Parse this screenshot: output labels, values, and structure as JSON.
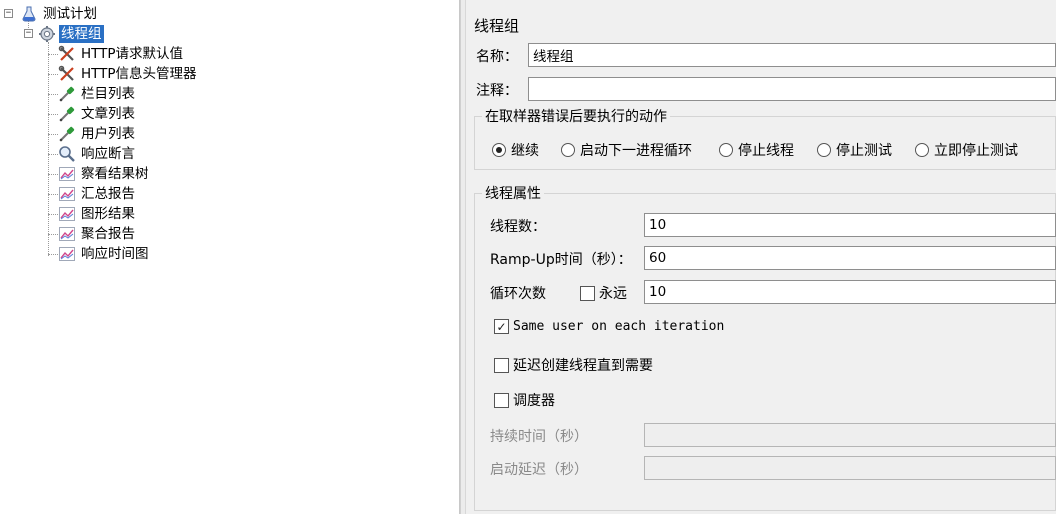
{
  "tree": {
    "root_label": "测试计划",
    "thread_group_label": "线程组",
    "children": [
      {
        "label": "HTTP请求默认值",
        "icon": "wrench-icon"
      },
      {
        "label": "HTTP信息头管理器",
        "icon": "wrench-icon"
      },
      {
        "label": "栏目列表",
        "icon": "pipette-icon"
      },
      {
        "label": "文章列表",
        "icon": "pipette-icon"
      },
      {
        "label": "用户列表",
        "icon": "pipette-icon"
      },
      {
        "label": "响应断言",
        "icon": "magnifier-icon"
      },
      {
        "label": "察看结果树",
        "icon": "graph-icon"
      },
      {
        "label": "汇总报告",
        "icon": "graph-icon"
      },
      {
        "label": "图形结果",
        "icon": "graph-icon"
      },
      {
        "label": "聚合报告",
        "icon": "graph-icon"
      },
      {
        "label": "响应时间图",
        "icon": "graph-icon"
      }
    ]
  },
  "form": {
    "title": "线程组",
    "name_label": "名称：",
    "name_value": "线程组",
    "comment_label": "注释：",
    "comment_value": "",
    "sampler_error": {
      "title": "在取样器错误后要执行的动作",
      "options": [
        "继续",
        "启动下一进程循环",
        "停止线程",
        "停止测试",
        "立即停止测试"
      ],
      "selected_index": 0
    },
    "thread_props": {
      "title": "线程属性",
      "threads_label": "线程数：",
      "threads_value": "10",
      "rampup_label": "Ramp-Up时间（秒）：",
      "rampup_value": "60",
      "loop_label": "循环次数",
      "forever_label": "永远",
      "forever_checked": false,
      "loop_value": "10",
      "same_user_label": "Same user on each iteration",
      "same_user_checked": true,
      "delay_label": "延迟创建线程直到需要",
      "delay_checked": false,
      "scheduler_label": "调度器",
      "scheduler_checked": false,
      "duration_label": "持续时间（秒）",
      "duration_value": "",
      "startup_delay_label": "启动延迟（秒）",
      "startup_delay_value": ""
    }
  },
  "colors": {
    "selection": "#2a70c4",
    "panel_bg": "#f0f0f0",
    "tree_bg": "#ffffff"
  }
}
